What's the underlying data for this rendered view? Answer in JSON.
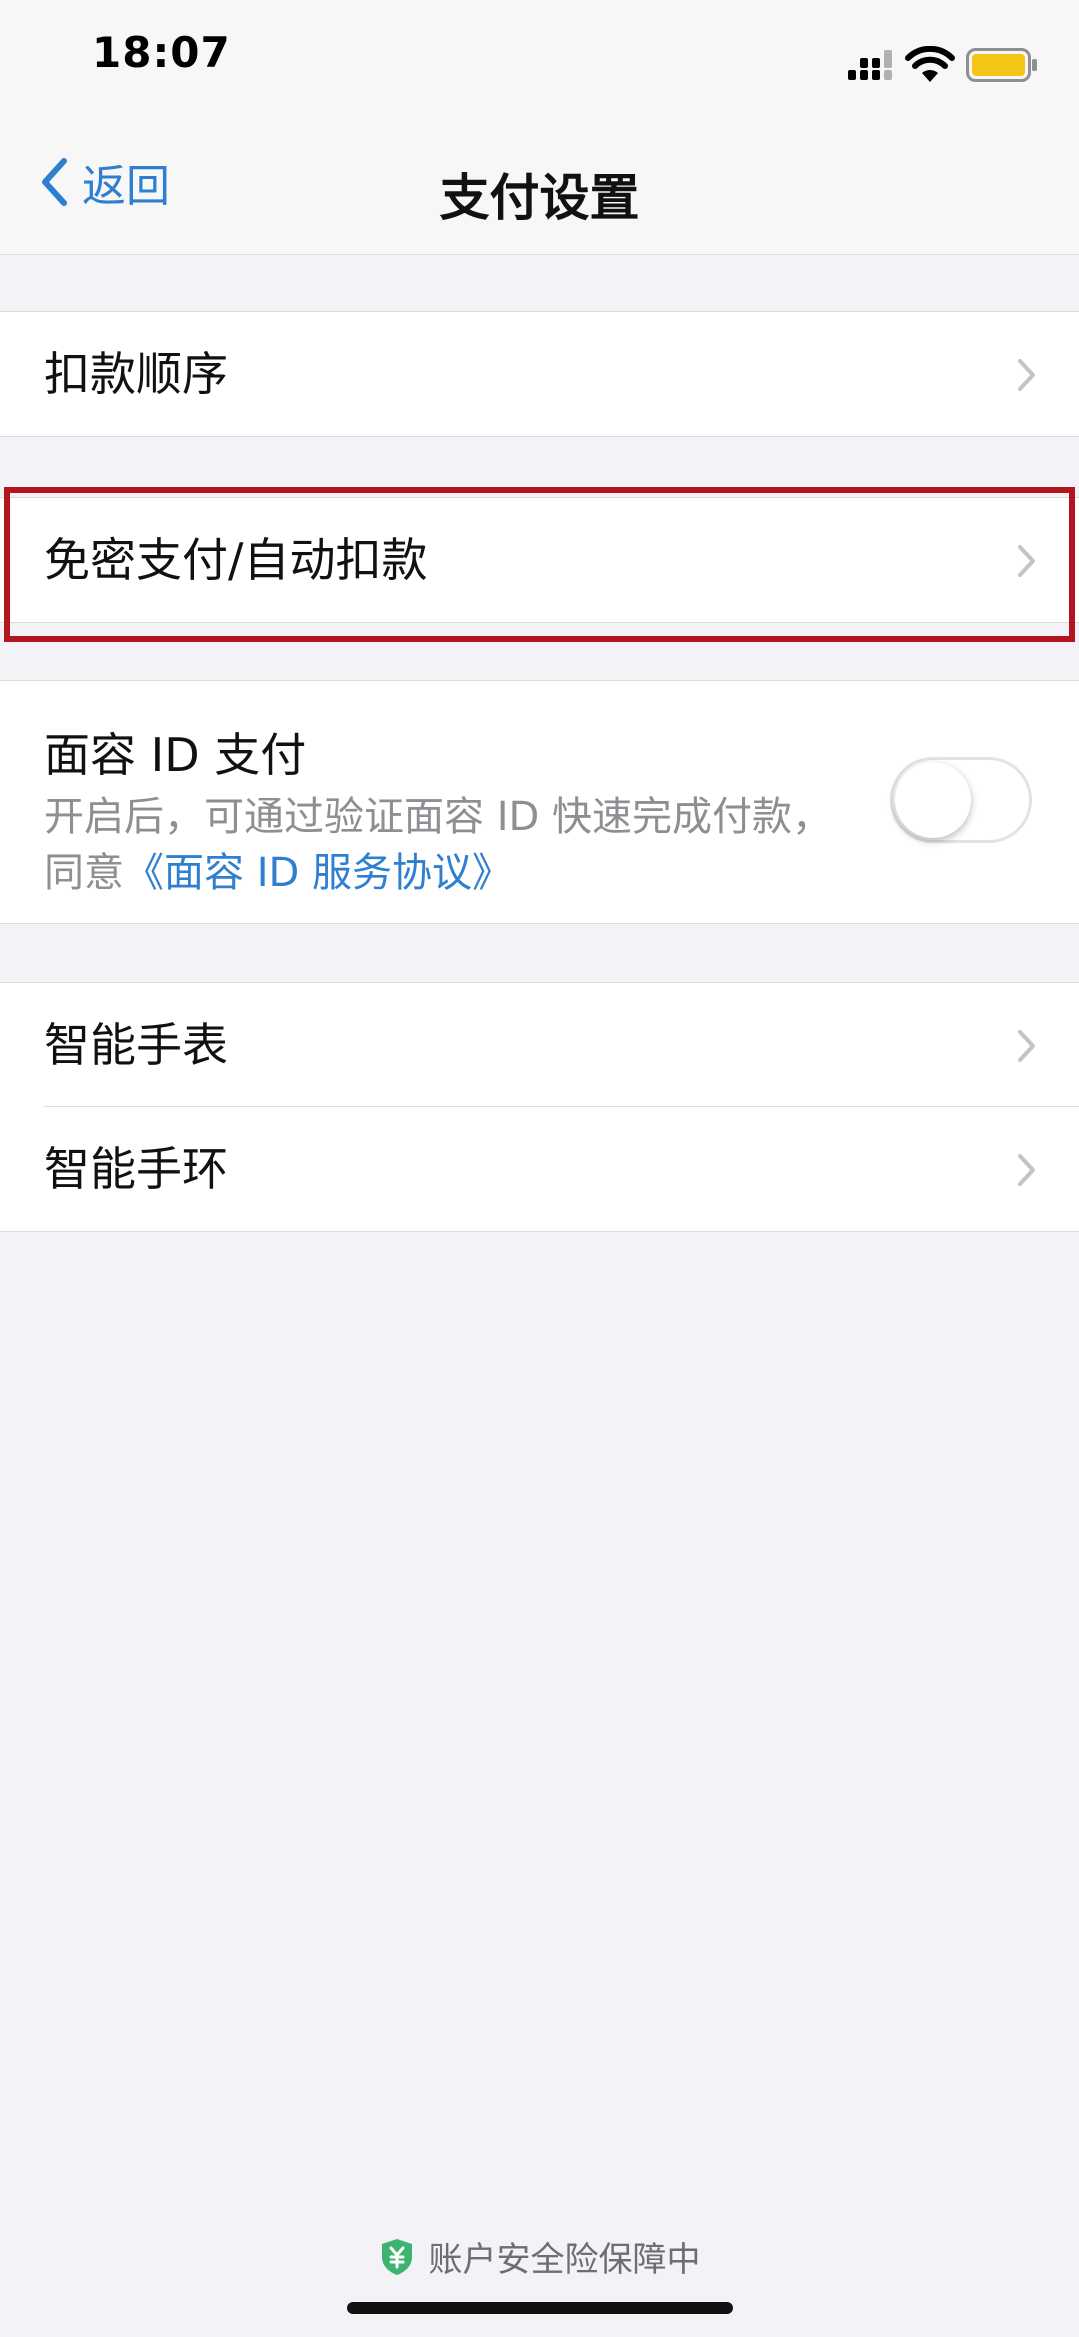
{
  "status_bar": {
    "time": "18:07"
  },
  "nav": {
    "back_label": "返回",
    "title": "支付设置"
  },
  "rows": {
    "deduction_order": "扣款顺序",
    "password_free": "免密支付/自动扣款",
    "smart_watch": "智能手表",
    "smart_band": "智能手环"
  },
  "face_id": {
    "title": "面容 ID 支付",
    "desc": "开启后，可通过验证面容 ID 快速完成付款，同意",
    "link": "《面容 ID 服务协议》",
    "enabled": false
  },
  "footer": {
    "text": "账户安全险保障中"
  },
  "colors": {
    "accent_blue": "#2f7fd1",
    "highlight_red": "#b3141d",
    "shield_green": "#3cb371",
    "battery_yellow": "#f5c518"
  },
  "icons": {
    "back": "chevron-left-icon",
    "row": "chevron-right-icon",
    "signal": "cellular-signal-icon",
    "wifi": "wifi-icon",
    "battery": "battery-icon",
    "shield": "yuan-shield-icon"
  }
}
